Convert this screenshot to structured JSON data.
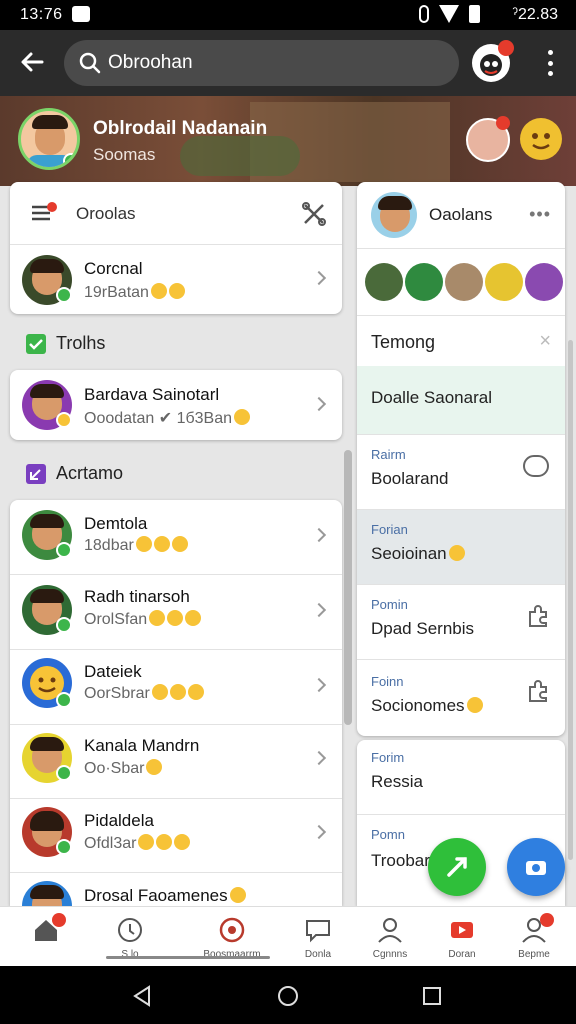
{
  "status_bar": {
    "time": "13:76",
    "time_right": "ˀ22.83"
  },
  "app_bar": {
    "back_icon": "arrow-left-icon",
    "search": {
      "placeholder": "Obroohan",
      "value": ""
    }
  },
  "profile": {
    "name": "Oblrodail Nadanain",
    "subtitle": "Soomas"
  },
  "left_panel": {
    "card1": {
      "title": "Oroolas",
      "row": {
        "name": "Corcnal",
        "sub": "19rBatan"
      }
    },
    "section_tools": {
      "label": "Trolhs"
    },
    "card2": {
      "row": {
        "name": "Bardava Sainotarl",
        "sub": "Ooodatan ✔ 1б3Ban"
      }
    },
    "section_contacts": {
      "label": "Acrtamo"
    },
    "contacts": [
      {
        "name": "Demtola",
        "sub": "18dbar",
        "avatar_color": "#3d8a3f"
      },
      {
        "name": "Radh tinarsoh",
        "sub": "OrolSfan",
        "avatar_color": "#2f6a34"
      },
      {
        "name": "Dateiek",
        "sub": "OorSbrar",
        "avatar_color": "#2a6bd6"
      },
      {
        "name": "Kanala Mandrn",
        "sub": "Oo·Sbar",
        "avatar_color": "#e6d430"
      },
      {
        "name": "Pidaldela",
        "sub": "Ofdl3ar",
        "avatar_color": "#b83a2c"
      },
      {
        "name": "Drosal Faoamenes",
        "sub": "",
        "avatar_color": "#2a7fd6"
      }
    ]
  },
  "right_panel": {
    "head": {
      "title": "Oaolans"
    },
    "trending": {
      "label": "Temong"
    },
    "featured": {
      "label": "Doalle Saonaral"
    },
    "items": [
      {
        "small": "Rairm",
        "label": "Boolarand"
      },
      {
        "small": "Forian",
        "label": "Seoioinan"
      },
      {
        "small": "Pomin",
        "label": "Dpad Sernbis"
      },
      {
        "small": "Foinn",
        "label": "Socionomes"
      },
      {
        "small": "Forim",
        "label": "Ressia"
      },
      {
        "small": "Pomn",
        "label": "Troobar"
      }
    ]
  },
  "bottom_nav": [
    {
      "label": "",
      "icon": "home-icon"
    },
    {
      "label": "S lo",
      "icon": "clock-icon"
    },
    {
      "label": "Boosmaarrm",
      "icon": "chat-icon"
    },
    {
      "label": "Donla",
      "icon": "message-icon"
    },
    {
      "label": "Cgnnns",
      "icon": "person-icon"
    },
    {
      "label": "Doran",
      "icon": "video-icon"
    },
    {
      "label": "Bepme",
      "icon": "profile-icon"
    }
  ],
  "colors": {
    "app_bar": "#2b2b2b",
    "accent_green": "#3cb54a",
    "fab_green": "#2fbf3a",
    "fab_blue": "#2f7fe0",
    "badge_red": "#e53b2c"
  }
}
